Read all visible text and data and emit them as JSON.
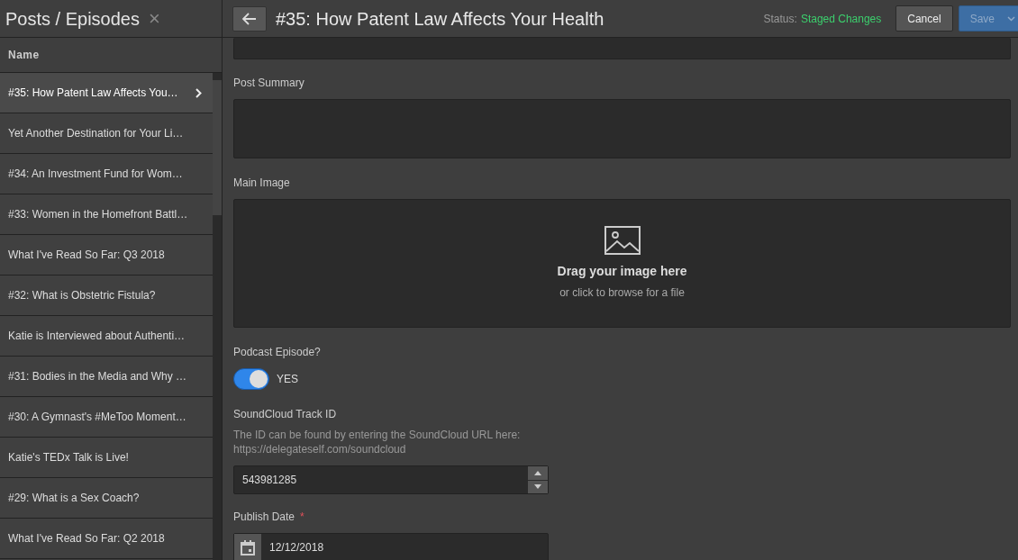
{
  "sidebar": {
    "title": "Posts / Episodes",
    "close": "×",
    "column": "Name",
    "items": [
      {
        "label": "#35: How Patent Law Affects You…",
        "selected": true
      },
      {
        "label": "Yet Another Destination for Your Li…",
        "selected": false
      },
      {
        "label": "#34: An Investment Fund for Wom…",
        "selected": false
      },
      {
        "label": "#33: Women in the Homefront Battl…",
        "selected": false
      },
      {
        "label": "What I've Read So Far: Q3 2018",
        "selected": false
      },
      {
        "label": "#32: What is Obstetric Fistula?",
        "selected": false
      },
      {
        "label": "Katie is Interviewed about Authenti…",
        "selected": false
      },
      {
        "label": "#31: Bodies in the Media and Why …",
        "selected": false
      },
      {
        "label": "#30: A Gymnast's #MeToo Moment…",
        "selected": false
      },
      {
        "label": "Katie's TEDx Talk is Live!",
        "selected": false
      },
      {
        "label": "#29: What is a Sex Coach?",
        "selected": false
      },
      {
        "label": "What I've Read So Far: Q2 2018",
        "selected": false
      }
    ]
  },
  "header": {
    "title": "#35: How Patent Law Affects Your Health",
    "status_label": "Status:",
    "status": "Staged Changes",
    "buttons": [
      {
        "label": "Cancel",
        "kind": "secondary",
        "disabled": false
      },
      {
        "label": "Save",
        "kind": "primary",
        "disabled": true
      }
    ]
  },
  "form": {
    "summary_label": "Post Summary",
    "image_label": "Main Image",
    "drop_title": "Drag your image here",
    "drop_hint": "or click to browse for a file",
    "podcast_label": "Podcast Episode?",
    "podcast_on": true,
    "podcast_text": "YES",
    "track_label": "SoundCloud Track ID",
    "track_help": "The ID can be found by entering the SoundCloud URL here: https://delegateself.com/soundcloud",
    "track_value": "543981285",
    "date_label": "Publish Date",
    "date_required": "*",
    "date_value": "12/12/2018"
  }
}
